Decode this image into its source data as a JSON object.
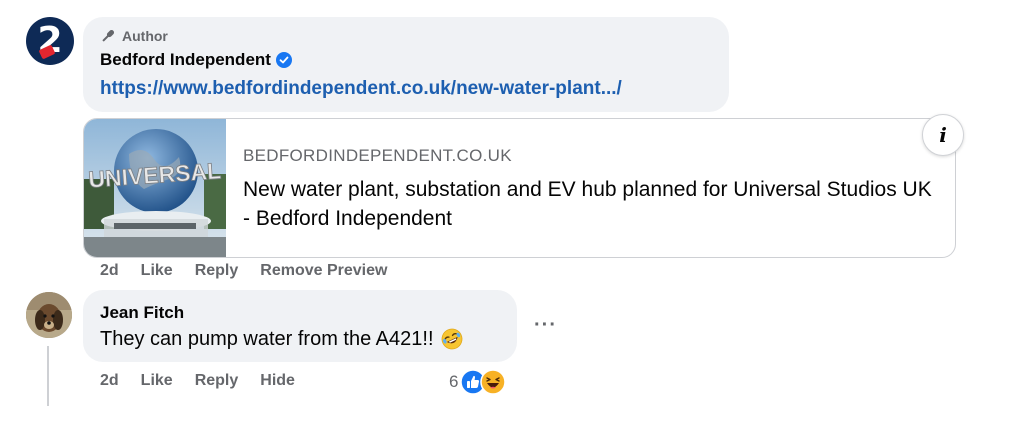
{
  "author_comment": {
    "badge_label": "Author",
    "commenter_name": "Bedford Independent",
    "link_text": "https://www.bedfordindependent.co.uk/new-water-plant.../",
    "preview": {
      "domain": "BEDFORDINDEPENDENT.CO.UK",
      "title": "New water plant, substation and EV hub planned for Universal Studios UK - Bedford Independent",
      "info_label": "i",
      "thumbnail_text": "UNIVERSAL"
    },
    "actions": {
      "time": "2d",
      "like": "Like",
      "reply": "Reply",
      "remove_preview": "Remove Preview"
    }
  },
  "reply_comment": {
    "commenter_name": "Jean Fitch",
    "text": "They can pump water from the A421!!",
    "more_label": "···",
    "actions": {
      "time": "2d",
      "like": "Like",
      "reply": "Reply",
      "hide": "Hide"
    },
    "reactions": {
      "count": "6",
      "types": [
        "like-icon",
        "haha-icon"
      ]
    }
  },
  "colors": {
    "bubble_bg": "#f0f2f5",
    "link": "#1d5fb0",
    "verified": "#1877f2",
    "muted_text": "#65676b"
  }
}
